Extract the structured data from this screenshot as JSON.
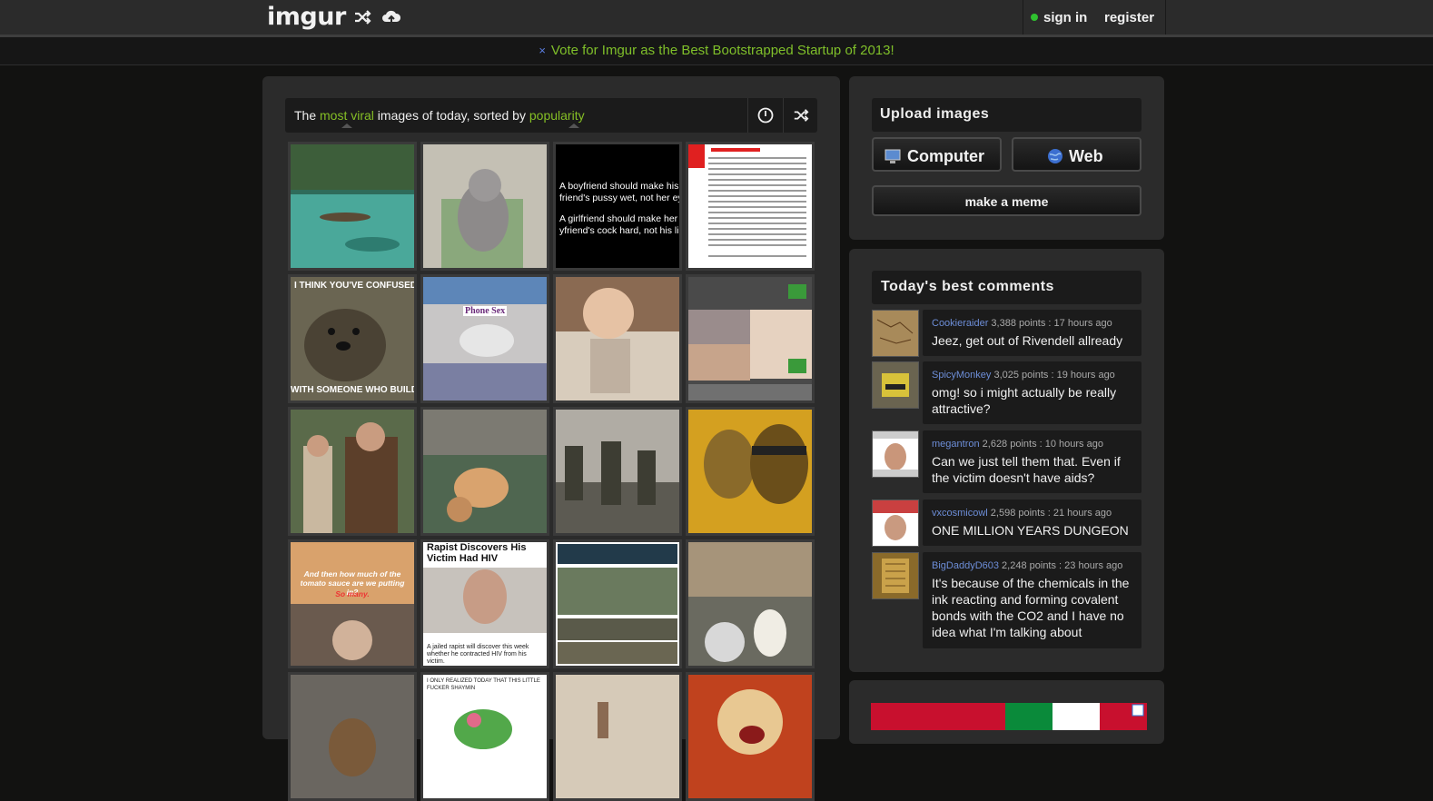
{
  "header": {
    "logo": "imgur",
    "signin_label": "sign in",
    "register_label": "register",
    "icons": [
      "shuffle-icon",
      "upload-cloud-icon"
    ]
  },
  "notice": {
    "close": "×",
    "text": "Vote for Imgur as the Best Bootstrapped Startup of 2013!"
  },
  "gallery": {
    "title_prefix": "The ",
    "title_highlight1": "most viral",
    "title_middle": " images of today, sorted by ",
    "title_highlight2": "popularity",
    "thumbnails": [
      {
        "alt": "swamp-canoe"
      },
      {
        "alt": "gray-cat-on-chair"
      },
      {
        "alt": "black-text-meme",
        "lines": [
          "A boyfriend should make his",
          "friend's pussy wet, not her ey",
          "A girlfriend should make her",
          "yfriend's cock hard, not his li"
        ]
      },
      {
        "alt": "long-text-screenshot"
      },
      {
        "alt": "otter-meme",
        "top": "I THINK YOU'VE CONFUSED ME",
        "bottom": "WITH SOMEONE WHO BUILDS A DA"
      },
      {
        "alt": "bed-phone",
        "label": "Phone Sex"
      },
      {
        "alt": "laughing-baby"
      },
      {
        "alt": "sims-comic"
      },
      {
        "alt": "movie-still-shotgun"
      },
      {
        "alt": "cat-on-blanket"
      },
      {
        "alt": "soldiers-walking"
      },
      {
        "alt": "breaking-bad-poster"
      },
      {
        "alt": "tomato-sauce-meme",
        "top": "And then how much of the tomato sauce are we putting in?",
        "mid": "So many."
      },
      {
        "alt": "news-hiv",
        "headline": "Rapist Discovers His Victim Had HIV",
        "caption": "A jailed rapist will discover this week whether he contracted HIV from his victim."
      },
      {
        "alt": "soldier-cartoon"
      },
      {
        "alt": "boy-with-dog"
      },
      {
        "alt": "dog-couch"
      },
      {
        "alt": "text-comic",
        "text": "I ONLY REALIZED TODAY THAT THIS LITTLE FUCKER SHAYMIN"
      },
      {
        "alt": "hand"
      },
      {
        "alt": "laughing-woman"
      }
    ]
  },
  "upload": {
    "title": "Upload images",
    "computer_label": "Computer",
    "web_label": "Web",
    "meme_label": "make a meme"
  },
  "comments": {
    "title": "Today's best comments",
    "items": [
      {
        "user": "Cookieraider",
        "meta": " 3,388 points : 17 hours ago",
        "text": "Jeez, get out of Rivendell allready"
      },
      {
        "user": "SpicyMonkey",
        "meta": " 3,025 points : 19 hours ago",
        "text": "omg! so i might actually be really attractive?"
      },
      {
        "user": "megantron",
        "meta": " 2,628 points : 10 hours ago",
        "text": "Can we just tell them that. Even if the victim doesn't have aids?"
      },
      {
        "user": "vxcosmicowl",
        "meta": " 2,598 points : 21 hours ago",
        "text": "ONE MILLION YEARS DUNGEON"
      },
      {
        "user": "BigDaddyD603",
        "meta": " 2,248 points : 23 hours ago",
        "text": "It's because of the chemicals in the ink reacting and forming covalent bonds with the CO2 and I have no idea what I'm talking about"
      }
    ]
  },
  "colors": {
    "accent_green": "#85bf25",
    "link_blue": "#6d8ed8",
    "panel_bg": "#2b2b2b",
    "page_bg": "#121211"
  }
}
